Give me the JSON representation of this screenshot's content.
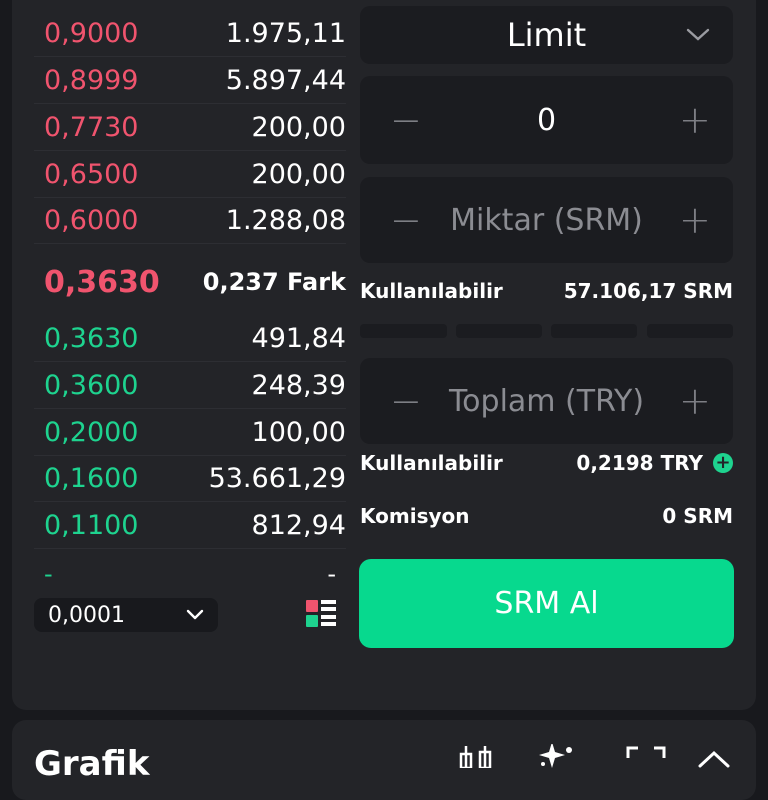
{
  "orderbook": {
    "asks": [
      {
        "price": "0,9000",
        "qty": "1.975,11"
      },
      {
        "price": "0,8999",
        "qty": "5.897,44"
      },
      {
        "price": "0,7730",
        "qty": "200,00"
      },
      {
        "price": "0,6500",
        "qty": "200,00"
      },
      {
        "price": "0,6000",
        "qty": "1.288,08"
      }
    ],
    "mid": {
      "price": "0,3630",
      "spread": "0,237 Fark"
    },
    "bids": [
      {
        "price": "0,3630",
        "qty": "491,84"
      },
      {
        "price": "0,3600",
        "qty": "248,39"
      },
      {
        "price": "0,2000",
        "qty": "100,00"
      },
      {
        "price": "0,1600",
        "qty": "53.661,29"
      },
      {
        "price": "0,1100",
        "qty": "812,94"
      }
    ],
    "empty_row": {
      "price": "-",
      "qty": "-"
    },
    "tick_size": "0,0001"
  },
  "form": {
    "order_type": "Limit",
    "price_value": "0",
    "amount_placeholder": "Miktar (SRM)",
    "available_srm_label": "Kullanılabilir",
    "available_srm_value": "57.106,17 SRM",
    "total_placeholder": "Toplam (TRY)",
    "available_try_label": "Kullanılabilir",
    "available_try_value": "0,2198 TRY",
    "commission_label": "Komisyon",
    "commission_value": "0 SRM",
    "buy_button": "SRM Al",
    "minus": "−",
    "plus": "+"
  },
  "chart_section": {
    "title": "Grafik"
  },
  "icons": [
    "chevron-down-icon",
    "minus-icon",
    "plus-icon",
    "add-funds-icon",
    "orderbook-view-icon",
    "candlestick-icon",
    "sparkle-icon",
    "fullscreen-icon",
    "chevron-up-icon"
  ],
  "colors": {
    "sell": "#f0546e",
    "buy": "#1ed38f",
    "button": "#07d98e",
    "panel": "#232428",
    "background": "#18191d"
  }
}
